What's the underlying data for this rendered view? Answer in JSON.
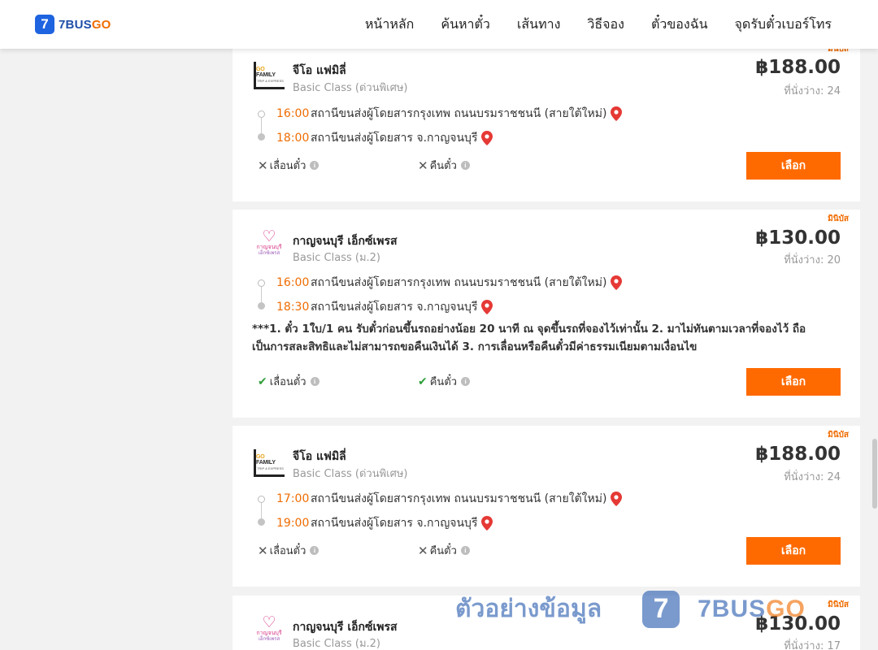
{
  "header": {
    "logo_badge": "7",
    "logo_text_a": "7BUS",
    "logo_text_b": "GO",
    "nav": [
      "หน้าหลัก",
      "ค้นหาตั๋ว",
      "เส้นทาง",
      "วิธีจอง",
      "ตั๋วของฉัน",
      "จุดรับตั๋วเบอร์โทร"
    ]
  },
  "cards": [
    {
      "tag": "มินิบัส",
      "operator": "จีโอ แฟมิลี่",
      "class": "Basic Class (ด่วนพิเศษ)",
      "price": "฿188.00",
      "seats": "ที่นั่งว่าง: 24",
      "depart_time": "16:00",
      "depart_place": "สถานีขนส่งผู้โดยสารกรุงเทพ ถนนบรมราชชนนี (สายใต้ใหม่)",
      "arrive_time": "18:00",
      "arrive_place": "สถานีขนส่งผู้โดยสาร จ.กาญจนบุรี",
      "change_label": "เลื่อนตั๋ว",
      "refund_label": "คืนตั๋ว",
      "change_allowed": false,
      "refund_allowed": false,
      "select_label": "เลือก"
    },
    {
      "tag": "มินิบัส",
      "operator": "กาญจนบุรี เอ็กซ์เพรส",
      "class": "Basic Class (ม.2)",
      "price": "฿130.00",
      "seats": "ที่นั่งว่าง: 20",
      "depart_time": "16:00",
      "depart_place": "สถานีขนส่งผู้โดยสารกรุงเทพ ถนนบรมราชชนนี (สายใต้ใหม่)",
      "arrive_time": "18:30",
      "arrive_place": "สถานีขนส่งผู้โดยสาร จ.กาญจนบุรี",
      "note": "***1. ตั๋ว 1ใบ/1 คน รับตั๋วก่อนขึ้นรถอย่างน้อย 20 นาที ณ จุดขึ้นรถที่จองไว้เท่านั้น 2. มาไม่ทันตามเวลาที่จองไว้ ถือเป็นการสละสิทธิและไม่สามารถขอคืนเงินได้ 3. การเลื่อนหรือคืนตั๋วมีค่าธรรมเนียมตามเงื่อนไข",
      "change_label": "เลื่อนตั๋ว",
      "refund_label": "คืนตั๋ว",
      "change_allowed": true,
      "refund_allowed": true,
      "select_label": "เลือก"
    },
    {
      "tag": "มินิบัส",
      "operator": "จีโอ แฟมิลี่",
      "class": "Basic Class (ด่วนพิเศษ)",
      "price": "฿188.00",
      "seats": "ที่นั่งว่าง: 24",
      "depart_time": "17:00",
      "depart_place": "สถานีขนส่งผู้โดยสารกรุงเทพ ถนนบรมราชชนนี (สายใต้ใหม่)",
      "arrive_time": "19:00",
      "arrive_place": "สถานีขนส่งผู้โดยสาร จ.กาญจนบุรี",
      "change_label": "เลื่อนตั๋ว",
      "refund_label": "คืนตั๋ว",
      "change_allowed": false,
      "refund_allowed": false,
      "select_label": "เลือก"
    },
    {
      "tag": "มินิบัส",
      "operator": "กาญจนบุรี เอ็กซ์เพรส",
      "class": "Basic Class (ม.2)",
      "price": "฿130.00",
      "seats": "ที่นั่งว่าง: 17"
    }
  ],
  "logos": {
    "gofamily_a": "GO ",
    "gofamily_b": "FAMILY",
    "gofamily_sub": "TRIP & EXPRESS",
    "kanchanaburi_a": "กาญจนบุรี",
    "kanchanaburi_b": "เอ็กซ์เพรส"
  },
  "watermark": {
    "text": "ตัวอย่างข้อมูล",
    "badge": "7",
    "brand_a": "7BUS",
    "brand_b": "GO"
  },
  "colors": {
    "accent_orange": "#ff6a00",
    "brand_blue": "#1e63e0",
    "time_orange": "#ef6c00",
    "check_green": "#2e9e3a",
    "pin_red": "#e53935"
  }
}
